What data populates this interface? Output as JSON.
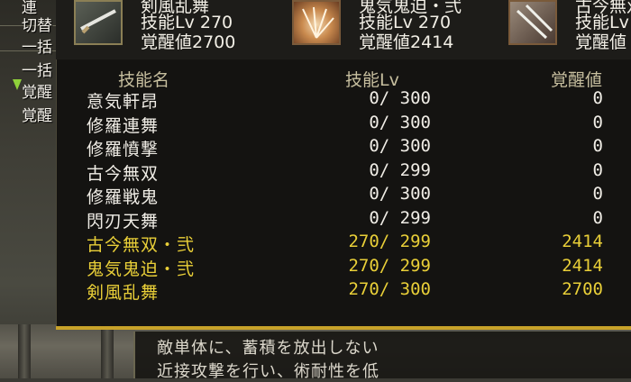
{
  "colors": {
    "accent_yellow": "#e9cf38",
    "text_white": "#f0ede6",
    "header": "#c7bf9f",
    "panel": "#131210"
  },
  "side_menu": {
    "items": [
      "連",
      "切替",
      "一括",
      "一括",
      "覚醒",
      "覚醒"
    ]
  },
  "selected_skills": [
    {
      "name": "剣風乱舞",
      "level": "技能Lv 270",
      "awakening": "覚醒値2700",
      "icon": "sword-icon"
    },
    {
      "name": "鬼気鬼迫・弐",
      "level": "技能Lv 270",
      "awakening": "覚醒値2414",
      "icon": "burst-icon"
    },
    {
      "name": "古今無双",
      "level": "技能Lv",
      "awakening": "覚醒値",
      "icon": "blades-icon"
    }
  ],
  "table": {
    "headers": {
      "name": "技能名",
      "level": "技能Lv",
      "awakening": "覚醒値"
    },
    "rows": [
      {
        "name": "意気軒昂",
        "level": "0/ 300",
        "awakening": "0",
        "owned": false
      },
      {
        "name": "修羅連舞",
        "level": "0/ 300",
        "awakening": "0",
        "owned": false
      },
      {
        "name": "修羅憤撃",
        "level": "0/ 300",
        "awakening": "0",
        "owned": false
      },
      {
        "name": "古今無双",
        "level": "0/ 299",
        "awakening": "0",
        "owned": false
      },
      {
        "name": "修羅戦鬼",
        "level": "0/ 300",
        "awakening": "0",
        "owned": false
      },
      {
        "name": "閃刃天舞",
        "level": "0/ 299",
        "awakening": "0",
        "owned": false
      },
      {
        "name": "古今無双・弐",
        "level": "270/ 299",
        "awakening": "2414",
        "owned": true
      },
      {
        "name": "鬼気鬼迫・弐",
        "level": "270/ 299",
        "awakening": "2414",
        "owned": true
      },
      {
        "name": "剣風乱舞",
        "level": "270/ 300",
        "awakening": "2700",
        "owned": true
      }
    ]
  },
  "description": {
    "lines": [
      "敵単体に、蓄積を放出しない",
      "近接攻撃を行い、術耐性を低"
    ]
  }
}
